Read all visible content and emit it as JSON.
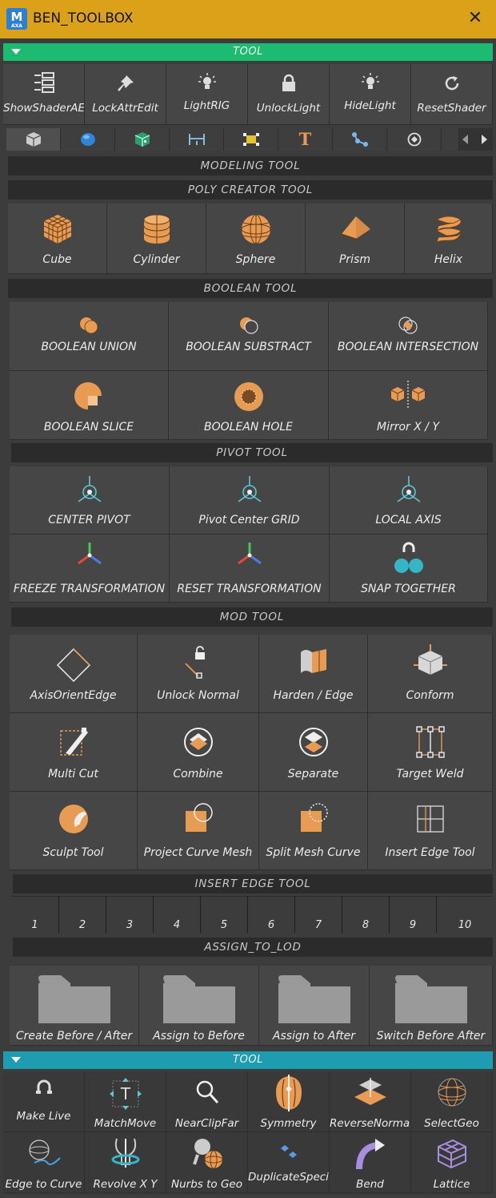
{
  "window": {
    "title": "BEN_TOOLBOX",
    "app_icon_letter": "M",
    "app_icon_sub": "AXA"
  },
  "colors": {
    "title_bar": "#dba219",
    "green_header": "#1dba72",
    "teal_header": "#1e9db1",
    "accent_orange": "#e89b52"
  },
  "top_header": {
    "label": "TOOL"
  },
  "top_tools": [
    {
      "label": "ShowShaderAE",
      "icon": "list-sliders-icon"
    },
    {
      "label": "LockAttrEdit",
      "icon": "pin-icon"
    },
    {
      "label": "LightRIG",
      "icon": "lightbulb-icon"
    },
    {
      "label": "UnlockLight",
      "icon": "lock-icon"
    },
    {
      "label": "HideLight",
      "icon": "lightbulb-icon"
    },
    {
      "label": "ResetShader",
      "icon": "refresh-icon"
    }
  ],
  "tabs": [
    {
      "icon": "cube-icon",
      "active": true
    },
    {
      "icon": "sphere-icon"
    },
    {
      "icon": "cube-pattern-icon"
    },
    {
      "icon": "measure-icon"
    },
    {
      "icon": "bounding-box-icon"
    },
    {
      "icon": "text-t-icon",
      "glyph": "T"
    },
    {
      "icon": "node-graph-icon"
    },
    {
      "icon": "rotate-icon"
    }
  ],
  "sections": {
    "modeling": "MODELING TOOL",
    "poly": "POLY CREATOR TOOL",
    "boolean": "BOOLEAN TOOL",
    "pivot": "PIVOT TOOL",
    "mod": "MOD TOOL",
    "insert_edge": "INSERT EDGE TOOL",
    "lod": "ASSIGN_TO_LOD"
  },
  "poly_tools": [
    "Cube",
    "Cylinder",
    "Sphere",
    "Prism",
    "Helix"
  ],
  "boolean_tools": [
    "BOOLEAN UNION",
    "BOOLEAN SUBSTRACT",
    "BOOLEAN INTERSECTION",
    "BOOLEAN SLICE",
    "BOOLEAN HOLE",
    "Mirror X / Y"
  ],
  "pivot_tools": [
    "CENTER PIVOT",
    "Pivot Center GRID",
    "LOCAL AXIS",
    "FREEZE TRANSFORMATION",
    "RESET TRANSFORMATION",
    "SNAP TOGETHER"
  ],
  "mod_tools": [
    "AxisOrientEdge",
    "Unlock Normal",
    "Harden / Edge",
    "Conform",
    "Multi Cut",
    "Combine",
    "Separate",
    "Target Weld",
    "Sculpt Tool",
    "Project Curve Mesh",
    "Split Mesh Curve",
    "Insert Edge Tool"
  ],
  "insert_edge_numbers": [
    "1",
    "2",
    "3",
    "4",
    "5",
    "6",
    "7",
    "8",
    "9",
    "10"
  ],
  "lod_tools": [
    "Create Before / After",
    "Assign to Before",
    "Assign to After",
    "Switch Before After"
  ],
  "bottom_header": {
    "label": "TOOL"
  },
  "bottom_tools": [
    {
      "label": "Make Live",
      "icon": "magnet-icon"
    },
    {
      "label": "MatchMove",
      "icon": "move-arrows-icon"
    },
    {
      "label": "NearClipFar",
      "icon": "magnifier-icon"
    },
    {
      "label": "Symmetry",
      "icon": "symmetry-icon"
    },
    {
      "label": "ReverseNormal",
      "icon": "normal-plane-icon"
    },
    {
      "label": "SelectGeo",
      "icon": "wire-sphere-icon"
    },
    {
      "label": "Edge to Curve",
      "icon": "edge-curve-icon"
    },
    {
      "label": "Revolve X Y",
      "icon": "revolve-icon"
    },
    {
      "label": "Nurbs to Geo",
      "icon": "nurbs-icon"
    },
    {
      "label": "DuplicateSpecial",
      "icon": "duplicate-icon"
    },
    {
      "label": "Bend",
      "icon": "bend-icon"
    },
    {
      "label": "Lattice",
      "icon": "lattice-icon"
    }
  ]
}
